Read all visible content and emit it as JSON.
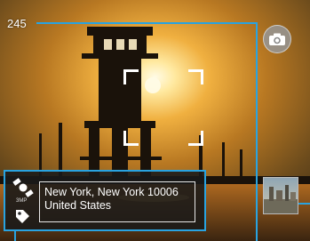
{
  "annotation": {
    "number": "245"
  },
  "camera": {
    "shutter_icon": "camera-icon",
    "focus_indicator": "focus-brackets"
  },
  "geotag": {
    "location_icon": "satellite-icon",
    "resolution": "3MP",
    "tag_icon": "tag-icon",
    "line1": "New York, New York 10006",
    "line2": "United States"
  },
  "thumbnail": {
    "icon": "last-photo-thumbnail"
  },
  "colors": {
    "callout": "#29a3e0",
    "sky_top": "#5a4a28",
    "sun": "#fff6d0"
  }
}
